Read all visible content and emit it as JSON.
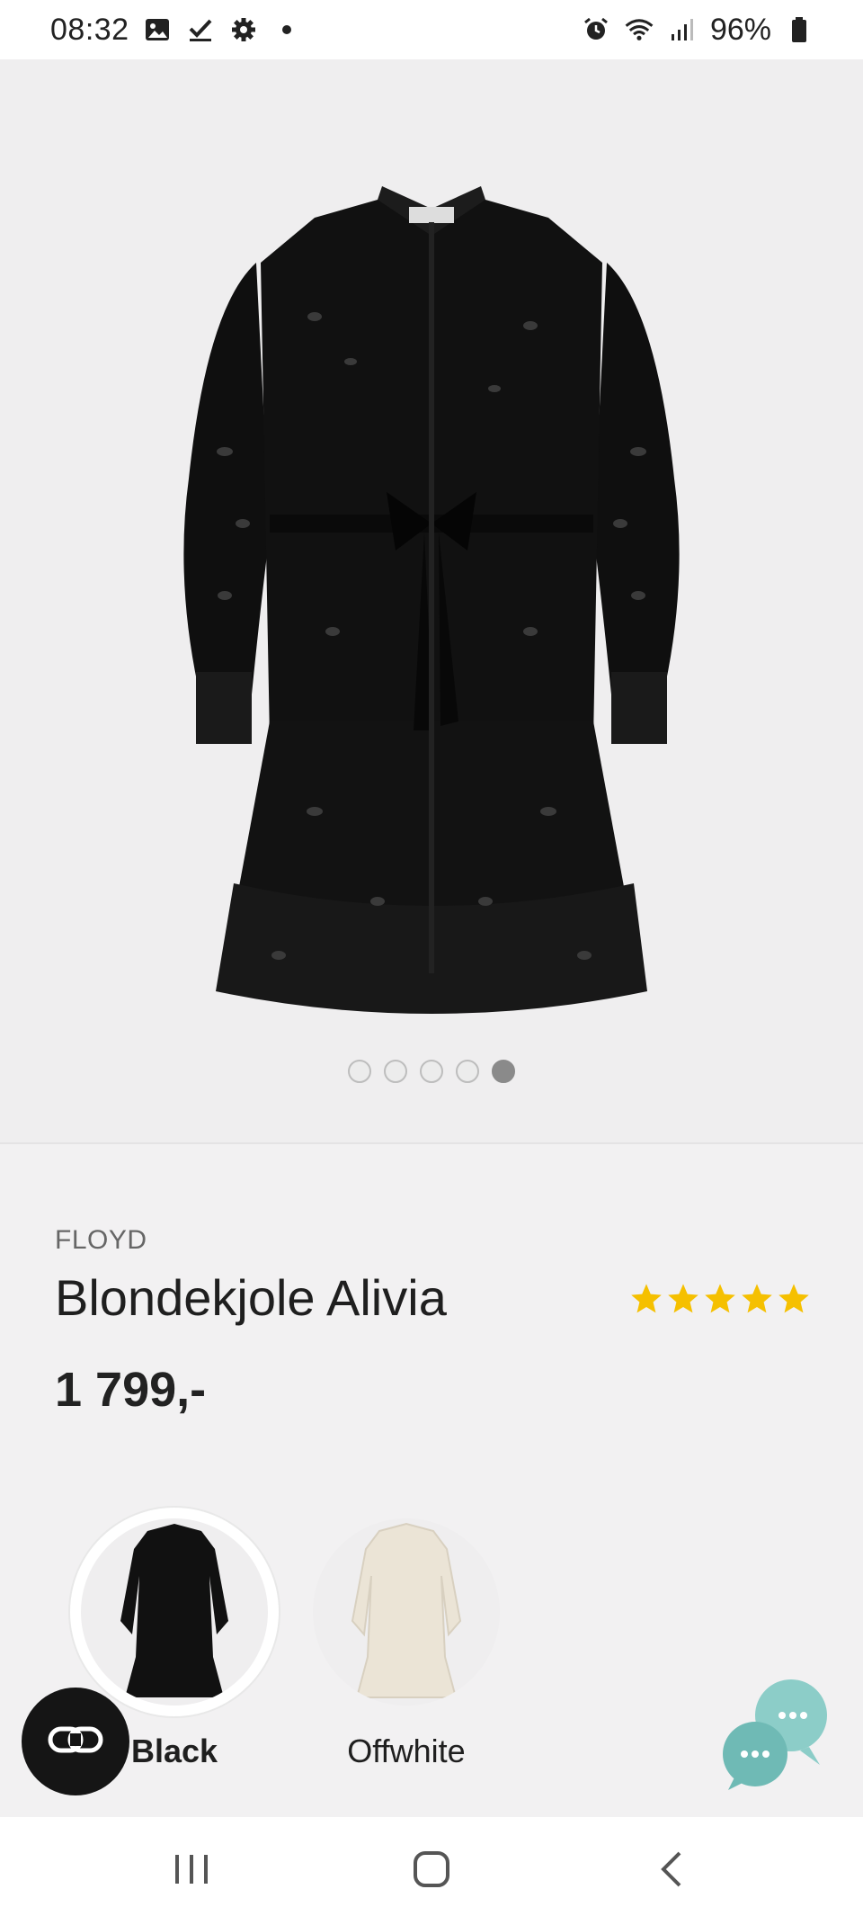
{
  "status_bar": {
    "time": "08:32",
    "battery": "96%",
    "left_icons": [
      "image-icon",
      "checkmark-icon",
      "gear-icon",
      "dot-icon"
    ],
    "right_icons": [
      "alarm-icon",
      "wifi-icon",
      "signal-icon",
      "battery-icon"
    ]
  },
  "gallery": {
    "image": "black-lace-dress",
    "image_count": 5,
    "active_index": 4
  },
  "product": {
    "brand": "FLOYD",
    "name": "Blondekjole Alivia",
    "price": "1 799,-",
    "rating": 5,
    "rating_max": 5,
    "star_color": "#f5c000"
  },
  "colors": [
    {
      "label": "Black",
      "selected": true,
      "swatch": "#111111"
    },
    {
      "label": "Offwhite",
      "selected": false,
      "swatch": "#eee9dd"
    }
  ],
  "fabs": {
    "link_icon": "link-icon",
    "chat_icon": "chat-bubbles-icon",
    "chat_color": "#79c2bd"
  },
  "nav": {
    "items": [
      "recent-apps-icon",
      "home-icon",
      "back-icon"
    ]
  }
}
